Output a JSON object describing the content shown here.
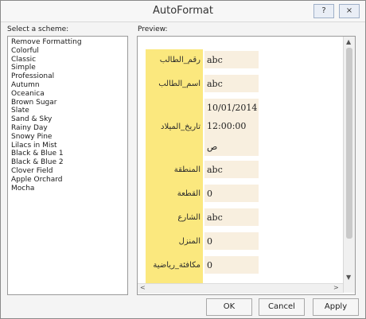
{
  "window": {
    "title": "AutoFormat"
  },
  "titlebar": {
    "help": "?",
    "close": "×"
  },
  "scheme": {
    "label": "Select a scheme:",
    "items": [
      "Remove Formatting",
      "Colorful",
      "Classic",
      "Simple",
      "Professional",
      "Autumn",
      "Oceanica",
      "Brown Sugar",
      "Slate",
      "Sand & Sky",
      "Rainy Day",
      "Snowy Pine",
      "Lilacs in Mist",
      "Black & Blue 1",
      "Black & Blue 2",
      "Clover Field",
      "Apple Orchard",
      "Mocha"
    ]
  },
  "preview": {
    "label": "Preview:",
    "rows": [
      {
        "label": "رقم_الطالب",
        "value": "abc"
      },
      {
        "label": "اسم_الطالب",
        "value": "abc"
      },
      {
        "label": "تاريخ_الميلاد",
        "value": "10/01/2014",
        "value2": "12:00:00",
        "value3": "ص"
      },
      {
        "label": "المنطقة",
        "value": "abc"
      },
      {
        "label": "القطعة",
        "value": "0"
      },
      {
        "label": "الشارع",
        "value": "abc"
      },
      {
        "label": "المنزل",
        "value": "0"
      },
      {
        "label": "مكافئة_رياضية",
        "value": "0"
      }
    ]
  },
  "buttons": {
    "ok": "OK",
    "cancel": "Cancel",
    "apply": "Apply"
  },
  "scroll": {
    "up": "▲",
    "down": "▼",
    "left": "<",
    "right": ">"
  }
}
